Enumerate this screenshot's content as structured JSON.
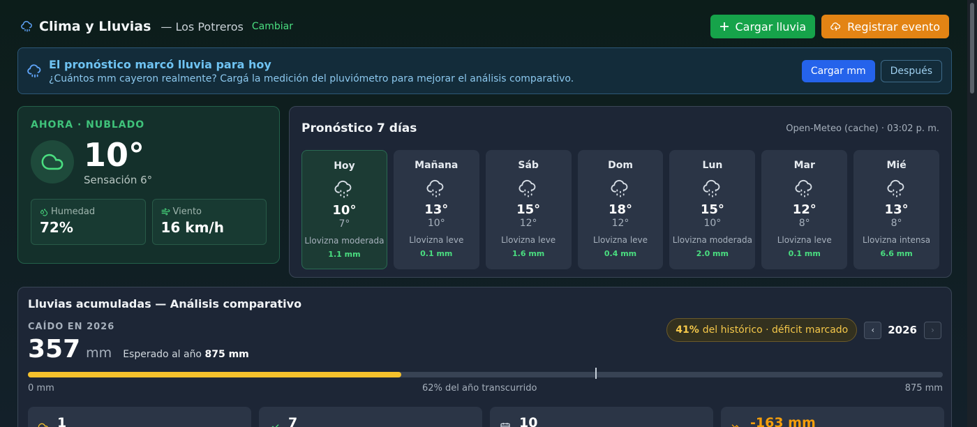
{
  "header": {
    "title": "Clima y Lluvias",
    "place": "— Los Potreros",
    "change_label": "Cambiar",
    "load_rain_label": "Cargar lluvia",
    "register_event_label": "Registrar evento"
  },
  "banner": {
    "title": "El pronóstico marcó lluvia para hoy",
    "subtitle": "¿Cuántos mm cayeron realmente? Cargá la medición del pluviómetro para mejorar el análisis comparativo.",
    "primary_label": "Cargar mm",
    "secondary_label": "Después"
  },
  "now": {
    "label": "AHORA · NUBLADO",
    "temp": "10°",
    "feels_like": "Sensación 6°",
    "humidity_label": "Humedad",
    "humidity_value": "72%",
    "wind_label": "Viento",
    "wind_value": "16 km/h"
  },
  "forecast": {
    "title": "Pronóstico 7 días",
    "source": "Open-Meteo (cache) · 03:02 p. m.",
    "days": [
      {
        "name": "Hoy",
        "max": "10°",
        "min": "7°",
        "desc": "Llovizna moderada",
        "mm": "1.1 mm"
      },
      {
        "name": "Mañana",
        "max": "13°",
        "min": "10°",
        "desc": "Llovizna leve",
        "mm": "0.1 mm"
      },
      {
        "name": "Sáb",
        "max": "15°",
        "min": "12°",
        "desc": "Llovizna leve",
        "mm": "1.6 mm"
      },
      {
        "name": "Dom",
        "max": "18°",
        "min": "12°",
        "desc": "Llovizna leve",
        "mm": "0.4 mm"
      },
      {
        "name": "Lun",
        "max": "15°",
        "min": "10°",
        "desc": "Llovizna moderada",
        "mm": "2.0 mm"
      },
      {
        "name": "Mar",
        "max": "12°",
        "min": "8°",
        "desc": "Llovizna leve",
        "mm": "0.1 mm"
      },
      {
        "name": "Mié",
        "max": "13°",
        "min": "8°",
        "desc": "Llovizna intensa",
        "mm": "6.6 mm"
      }
    ]
  },
  "rain": {
    "title": "Lluvias acumuladas — Análisis comparativo",
    "fallen_label": "CAÍDO EN 2026",
    "fallen_value": "357",
    "unit": "mm",
    "expected_prefix": "Esperado al año",
    "expected_value": "875 mm",
    "deficit_pct": "41%",
    "deficit_text": "del histórico · déficit marcado",
    "year": "2026",
    "prev_label": "‹",
    "next_label": "›",
    "progress_fraction": 0.408,
    "year_elapsed_fraction": 0.62,
    "axis_min": "0 mm",
    "axis_mid": "62% del año transcurrido",
    "axis_max": "875 mm",
    "mini_stats": [
      "1",
      "7",
      "10",
      "-163 mm"
    ]
  },
  "colors": {
    "accent_green": "#16a34a",
    "accent_orange": "#e38414",
    "accent_blue": "#2563eb",
    "progress_yellow": "#f5c12c"
  }
}
